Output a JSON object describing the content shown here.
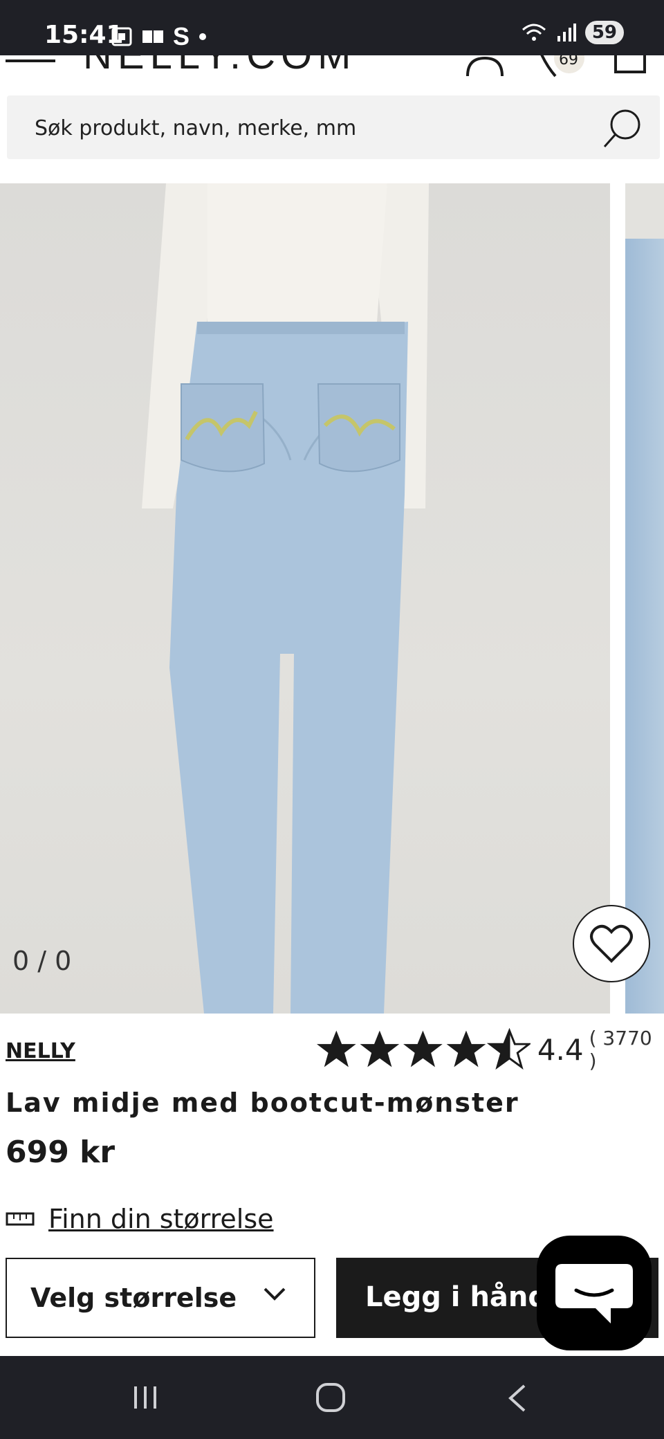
{
  "status_bar": {
    "time": "15:41",
    "carrier_letter": "S",
    "battery": "59"
  },
  "header": {
    "logo": "NELLY.COM",
    "wishlist_count": "69"
  },
  "search": {
    "placeholder": "Søk produkt, navn, merke, mm"
  },
  "gallery": {
    "counter": "0 / 0"
  },
  "product": {
    "brand": "NELLY",
    "rating": "4.4",
    "rating_count": "( 3770 )",
    "stars_filled": 4.5,
    "title": "Lav midje med bootcut-mønster",
    "price": "699 kr"
  },
  "size_guide": {
    "label": "Finn din størrelse"
  },
  "actions": {
    "size_select_label": "Velg størrelse",
    "add_to_cart_label": "Legg i håndkurv"
  },
  "colors": {
    "status_bar_bg": "#1f2026",
    "search_bg": "#f2f2f2",
    "button_dark": "#1b1b1b",
    "jeans_blue": "#a9c3dc"
  }
}
